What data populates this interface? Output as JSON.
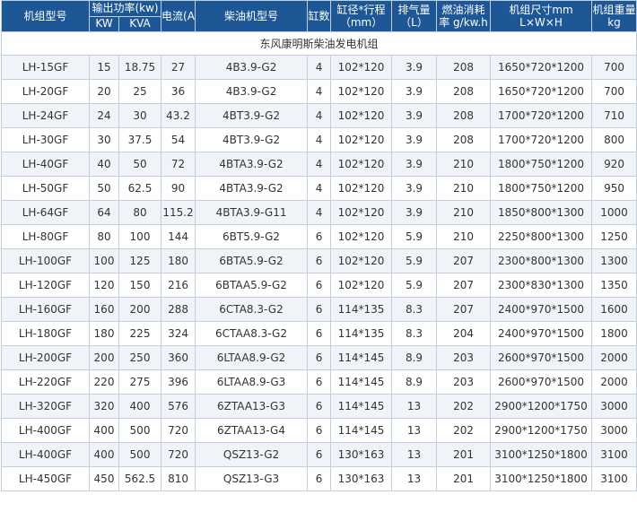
{
  "headers": {
    "model": "机组型号",
    "output_power": "输出功率(kw)",
    "kw": "KW",
    "kva": "KVA",
    "current": "电流(A)",
    "engine": "柴油机型号",
    "cylinders": "缸数",
    "bore_stroke_l1": "缸径*行程",
    "bore_stroke_l2": "（mm）",
    "displacement_l1": "排气量",
    "displacement_l2": "（L）",
    "fuel_l1": "燃油消耗",
    "fuel_l2": "率 g/kw.h",
    "dimensions_l1": "机组尺寸mm",
    "dimensions_l2": "L×W×H",
    "weight_l1": "机组重量",
    "weight_l2": "kg"
  },
  "group_title": "东风康明斯柴油发电机组",
  "rows": [
    [
      "LH-15GF",
      "15",
      "18.75",
      "27",
      "4B3.9-G2",
      "4",
      "102*120",
      "3.9",
      "208",
      "1650*720*1200",
      "700"
    ],
    [
      "LH-20GF",
      "20",
      "25",
      "36",
      "4B3.9-G2",
      "4",
      "102*120",
      "3.9",
      "208",
      "1650*720*1200",
      "700"
    ],
    [
      "LH-24GF",
      "24",
      "30",
      "43.2",
      "4BT3.9-G2",
      "4",
      "102*120",
      "3.9",
      "208",
      "1700*720*1200",
      "710"
    ],
    [
      "LH-30GF",
      "30",
      "37.5",
      "54",
      "4BT3.9-G2",
      "4",
      "102*120",
      "3.9",
      "208",
      "1700*720*1200",
      "800"
    ],
    [
      "LH-40GF",
      "40",
      "50",
      "72",
      "4BTA3.9-G2",
      "4",
      "102*120",
      "3.9",
      "210",
      "1800*750*1200",
      "920"
    ],
    [
      "LH-50GF",
      "50",
      "62.5",
      "90",
      "4BTA3.9-G2",
      "4",
      "102*120",
      "3.9",
      "210",
      "1800*750*1200",
      "950"
    ],
    [
      "LH-64GF",
      "64",
      "80",
      "115.2",
      "4BTA3.9-G11",
      "4",
      "102*120",
      "3.9",
      "210",
      "1850*800*1300",
      "1000"
    ],
    [
      "LH-80GF",
      "80",
      "100",
      "144",
      "6BT5.9-G2",
      "6",
      "102*120",
      "5.9",
      "210",
      "2250*800*1300",
      "1250"
    ],
    [
      "LH-100GF",
      "100",
      "125",
      "180",
      "6BTA5.9-G2",
      "6",
      "102*120",
      "5.9",
      "207",
      "2300*800*1300",
      "1300"
    ],
    [
      "LH-120GF",
      "120",
      "150",
      "216",
      "6BTAA5.9-G2",
      "6",
      "102*120",
      "5.9",
      "207",
      "2300*830*1300",
      "1350"
    ],
    [
      "LH-160GF",
      "160",
      "200",
      "288",
      "6CTA8.3-G2",
      "6",
      "114*135",
      "8.3",
      "207",
      "2400*970*1500",
      "1600"
    ],
    [
      "LH-180GF",
      "180",
      "225",
      "324",
      "6CTAA8.3-G2",
      "6",
      "114*135",
      "8.3",
      "204",
      "2400*970*1500",
      "1800"
    ],
    [
      "LH-200GF",
      "200",
      "250",
      "360",
      "6LTAA8.9-G2",
      "6",
      "114*145",
      "8.9",
      "203",
      "2600*970*1500",
      "2000"
    ],
    [
      "LH-220GF",
      "220",
      "275",
      "396",
      "6LTAA8.9-G3",
      "6",
      "114*145",
      "8.9",
      "203",
      "2600*970*1500",
      "2000"
    ],
    [
      "LH-320GF",
      "320",
      "400",
      "576",
      "6ZTAA13-G3",
      "6",
      "114*145",
      "13",
      "202",
      "2900*1200*1750",
      "3000"
    ],
    [
      "LH-400GF",
      "400",
      "500",
      "720",
      "6ZTAA13-G4",
      "6",
      "114*145",
      "13",
      "202",
      "2900*1200*1750",
      "3000"
    ],
    [
      "LH-400GF",
      "400",
      "500",
      "720",
      "QSZ13-G2",
      "6",
      "130*163",
      "13",
      "201",
      "3100*1250*1800",
      "3100"
    ],
    [
      "LH-450GF",
      "450",
      "562.5",
      "810",
      "QSZ13-G3",
      "6",
      "130*163",
      "13",
      "201",
      "3100*1250*1800",
      "3100"
    ]
  ],
  "colors": {
    "header_bg": "#1d5796",
    "header_text": "#ffffff",
    "border": "#c3cfe0",
    "row_alt": "#f0f3f8",
    "text": "#333333"
  }
}
